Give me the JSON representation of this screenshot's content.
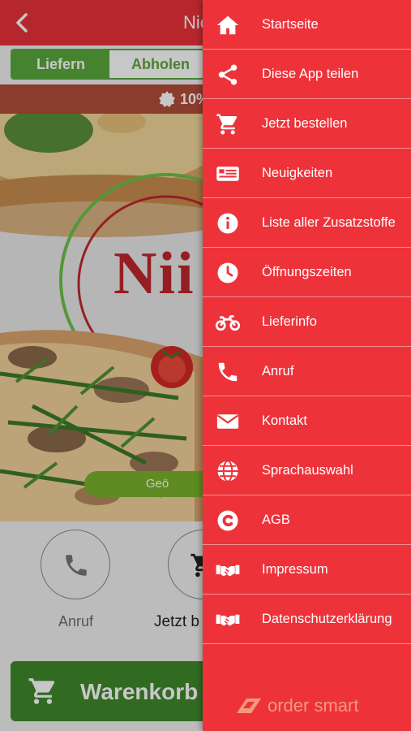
{
  "header": {
    "title": "Nic",
    "back_icon": "chevron-left-icon"
  },
  "order_mode": {
    "options": [
      "Liefern",
      "Abholen"
    ],
    "selected": "Liefern"
  },
  "promo": {
    "text": "10%",
    "icon": "badge-icon"
  },
  "hero": {
    "logo_text": "Nii",
    "pill_text": "Geö"
  },
  "quick_actions": [
    {
      "label": "Anruf",
      "icon": "phone-icon"
    },
    {
      "label": "Jetzt b",
      "icon": "cart-icon"
    }
  ],
  "cart_button": {
    "label": "Warenkorb",
    "icon": "cart-icon"
  },
  "menu": {
    "items": [
      {
        "label": "Startseite",
        "icon": "home-icon"
      },
      {
        "label": "Diese App teilen",
        "icon": "share-icon"
      },
      {
        "label": "Jetzt bestellen",
        "icon": "cart-icon"
      },
      {
        "label": "Neuigkeiten",
        "icon": "newspaper-icon"
      },
      {
        "label": "Liste aller Zusatzstoffe",
        "icon": "info-icon"
      },
      {
        "label": "Öffnungszeiten",
        "icon": "clock-icon"
      },
      {
        "label": "Lieferinfo",
        "icon": "motorbike-icon"
      },
      {
        "label": "Anruf",
        "icon": "phone-icon"
      },
      {
        "label": "Kontakt",
        "icon": "mail-icon"
      },
      {
        "label": "Sprachauswahl",
        "icon": "globe-icon"
      },
      {
        "label": "AGB",
        "icon": "copyright-icon"
      },
      {
        "label": "Impressum",
        "icon": "handshake-icon"
      },
      {
        "label": "Datenschutzerklärung",
        "icon": "handshake-icon"
      }
    ],
    "brand": "order smart"
  },
  "colors": {
    "menu_bg": "#ee323a",
    "header_bg": "#e8323a",
    "accent_green": "#5aa83d",
    "cart_green": "#3f8a2c",
    "brand_orange": "#f39a7c"
  }
}
